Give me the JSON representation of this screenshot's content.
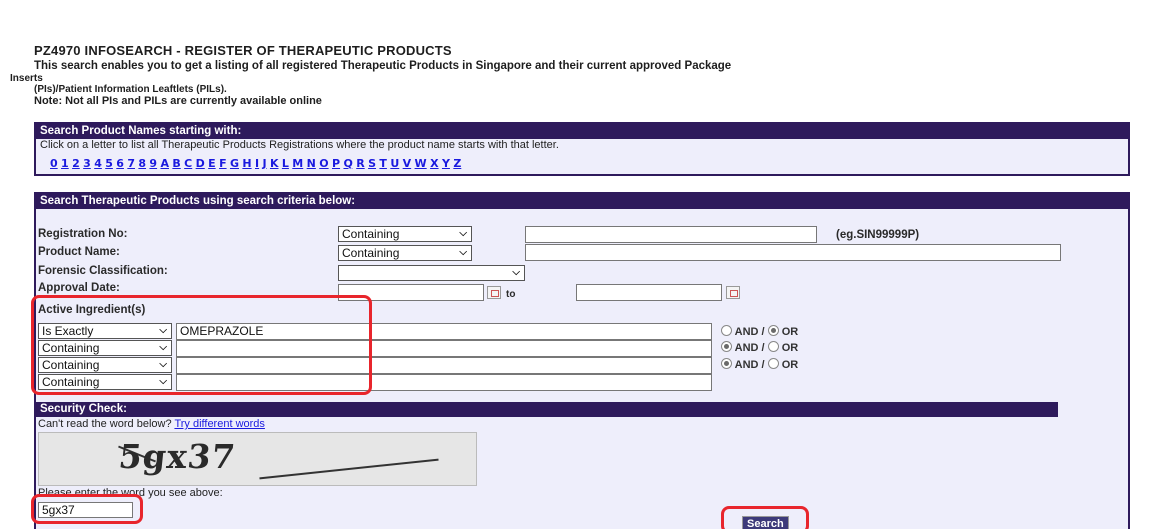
{
  "title": "PZ4970 INFOSEARCH - REGISTER OF THERAPEUTIC PRODUCTS",
  "intro": {
    "line1": "This search enables you to get a listing of all registered Therapeutic Products in Singapore and their current approved Package",
    "line2": "Inserts",
    "line3": "(PIs)/Patient Information Leaftlets (PILs).",
    "line4": "Note: Not all PIs and PILs are currently available online"
  },
  "letters_panel": {
    "heading": "Search Product Names starting with:",
    "help": "Click on a letter to list all Therapeutic Products Registrations where the product name starts with that letter.",
    "letters": [
      "0",
      "1",
      "2",
      "3",
      "4",
      "5",
      "6",
      "7",
      "8",
      "9",
      "A",
      "B",
      "C",
      "D",
      "E",
      "F",
      "G",
      "H",
      "I",
      "J",
      "K",
      "L",
      "M",
      "N",
      "O",
      "P",
      "Q",
      "R",
      "S",
      "T",
      "U",
      "V",
      "W",
      "X",
      "Y",
      "Z"
    ]
  },
  "criteria_panel": {
    "heading": "Search Therapeutic Products using search criteria below:",
    "registration_no": {
      "label": "Registration No:",
      "operator": "Containing",
      "value": "",
      "hint": "(eg.SIN99999P)"
    },
    "product_name": {
      "label": "Product Name:",
      "operator": "Containing",
      "value": ""
    },
    "forensic": {
      "label": "Forensic Classification:",
      "value": ""
    },
    "approval_date": {
      "label": "Approval Date:",
      "from": "",
      "to_label": "to",
      "to": ""
    },
    "active_ingredients": {
      "label": "Active Ingredient(s)",
      "rows": [
        {
          "operator": "Is Exactly",
          "value": "OMEPRAZOLE",
          "and_label": "AND /",
          "or_label": "OR",
          "selected": "OR"
        },
        {
          "operator": "Containing",
          "value": "",
          "and_label": "AND /",
          "or_label": "OR",
          "selected": "AND"
        },
        {
          "operator": "Containing",
          "value": "",
          "and_label": "AND /",
          "or_label": "OR",
          "selected": "AND"
        },
        {
          "operator": "Containing",
          "value": ""
        }
      ]
    }
  },
  "security": {
    "heading": "Security Check:",
    "cant_read": "Can't read the word below?",
    "try_link": "Try different words",
    "captcha_word": "5gx37",
    "enter_label": "Please enter the word you see above:",
    "input_value": "5gx37",
    "search_button": "Search"
  },
  "colors": {
    "panel_header": "#2e1a5c",
    "panel_bg": "#eeeefb",
    "link": "#1a1adf",
    "highlight": "#e8252c"
  }
}
